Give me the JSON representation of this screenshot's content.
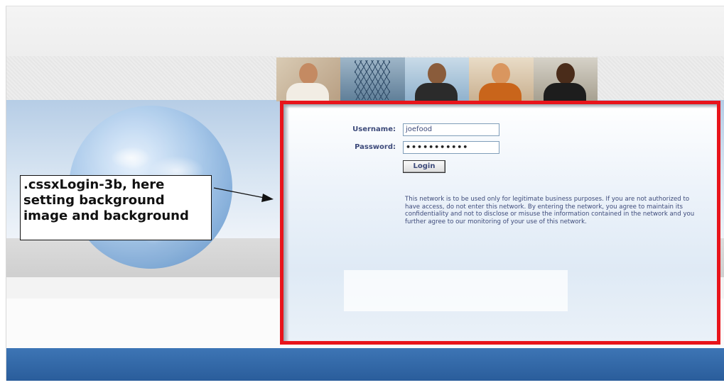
{
  "form": {
    "username_label": "Username:",
    "username_value": "joefood",
    "password_label": "Password:",
    "password_value": "•••••••••••",
    "login_button": "Login"
  },
  "notice": "This network is to be used only for legitimate business purposes. If you are not authorized to have access, do not enter this network. By entering the network, you agree to maintain its confidentiality and not to disclose or misuse the information contained in the network and you further agree to our monitoring of your use of this network.",
  "annotation": {
    "callout_text": ".cssxLogin-3b, here setting background image and background"
  },
  "colors": {
    "highlight_border": "#e8141b",
    "label_text": "#3d4a7a",
    "footer_bar": "#2a5d9b"
  },
  "icons": {
    "globe": "globe-graphic",
    "arrow": "arrow-right"
  }
}
